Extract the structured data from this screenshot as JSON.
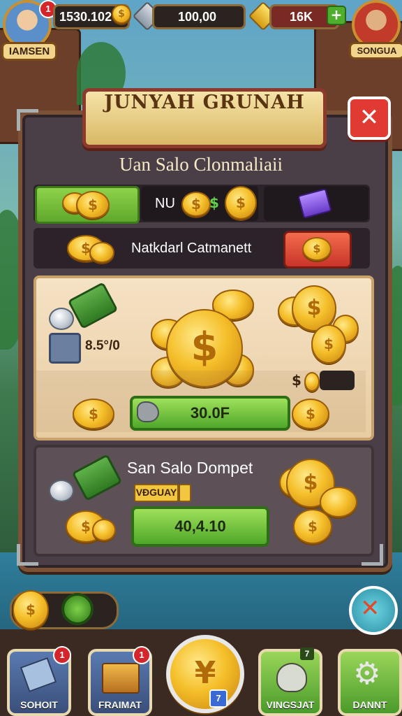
{
  "top_bar": {
    "left_player_name": "IAMSEN",
    "right_player_name": "SONGUA",
    "left_badge": "1",
    "coins_value": "1530.102",
    "silver_value": "100,00",
    "gold_value": "16K"
  },
  "dialog": {
    "title": "JUNYAH GRUNAH",
    "close_icon": "close-icon",
    "subtitle": "Uan Salo Clonmaliaii",
    "row1": {
      "label": "NU",
      "currency_symbol": "$"
    },
    "row2": {
      "label": "Natkdarl Catmanett"
    },
    "card1": {
      "amount": "8.5°/0",
      "price": "30.0F",
      "tag_symbol": "$"
    },
    "card2": {
      "title": "San Salo Dompet",
      "tag": "VÐGUAY",
      "price": "40,4.10"
    }
  },
  "dock": {
    "items": [
      {
        "label": "SOHOIT",
        "badge": "1"
      },
      {
        "label": "FRAIMAT",
        "badge": "1"
      },
      {
        "label": "",
        "badge": "7"
      },
      {
        "label": "VINGSJAT",
        "badge": "7"
      },
      {
        "label": "DANNT",
        "badge": ""
      }
    ],
    "center_glyph": "¥"
  },
  "colors": {
    "panel": "#4b3f47",
    "accent_gold": "#f5bf2a",
    "button_green": "#5ea82c",
    "button_red": "#e03a32"
  }
}
